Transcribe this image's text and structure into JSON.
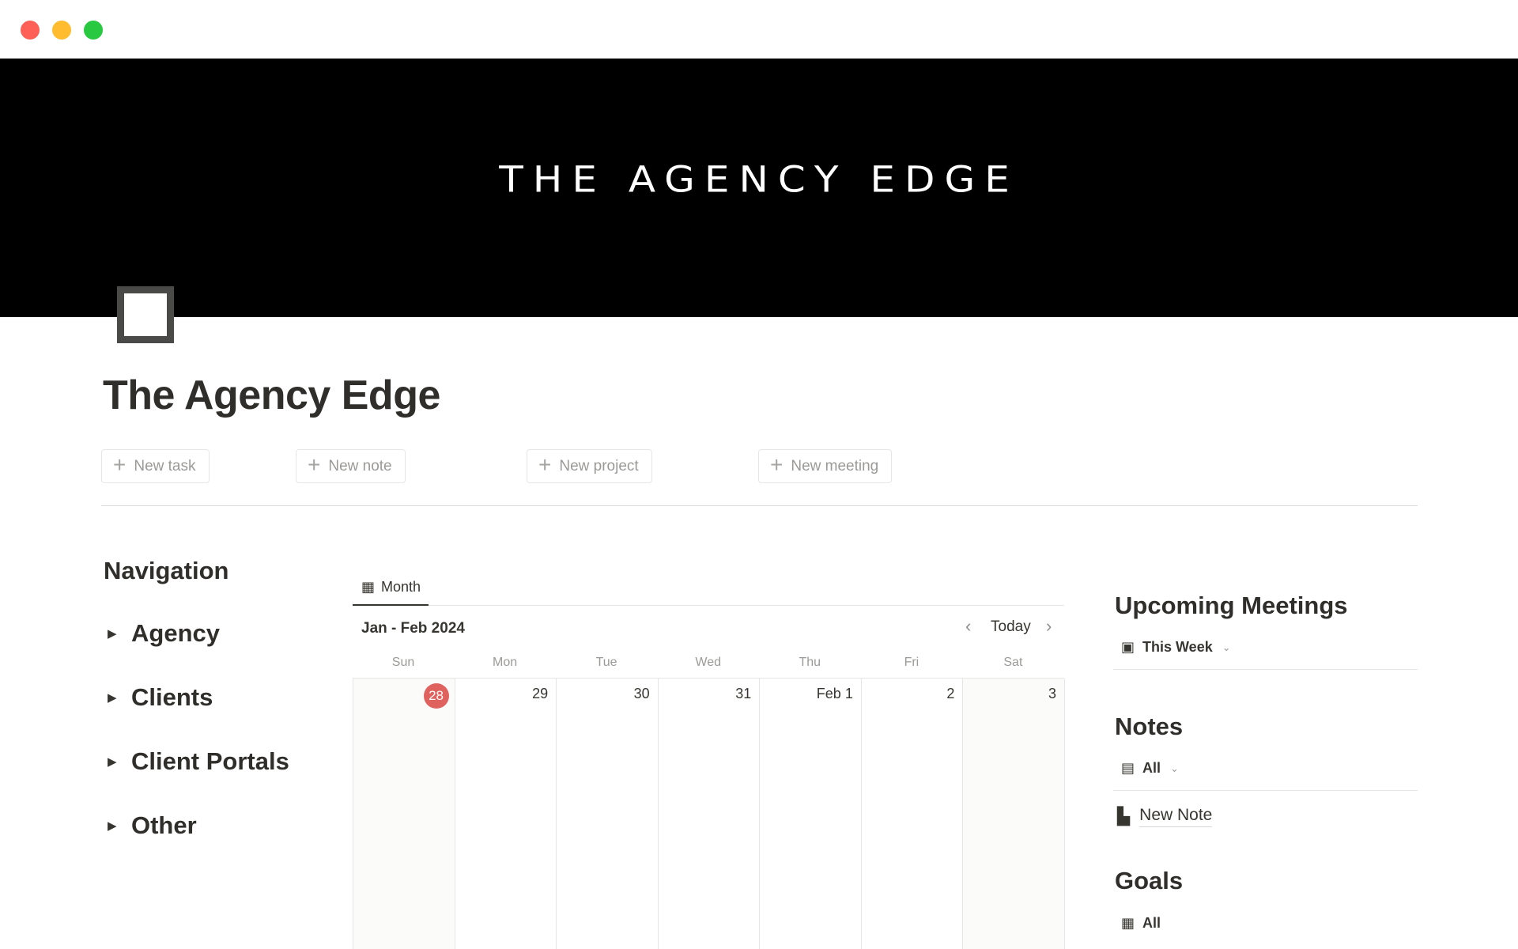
{
  "cover": {
    "title": "THE AGENCY EDGE"
  },
  "page": {
    "title": "The Agency Edge"
  },
  "actions": {
    "new_task": "New task",
    "new_note": "New note",
    "new_project": "New project",
    "new_meeting": "New meeting"
  },
  "navigation": {
    "heading": "Navigation",
    "items": [
      "Agency",
      "Clients",
      "Client Portals",
      "Other"
    ]
  },
  "calendar": {
    "tab": "Month",
    "range": "Jan - Feb 2024",
    "today_label": "Today",
    "weekdays": [
      "Sun",
      "Mon",
      "Tue",
      "Wed",
      "Thu",
      "Fri",
      "Sat"
    ],
    "days": [
      "28",
      "29",
      "30",
      "31",
      "Feb 1",
      "2",
      "3"
    ],
    "today_day": "28"
  },
  "upcoming_meetings": {
    "heading": "Upcoming Meetings",
    "view": "This Week"
  },
  "notes": {
    "heading": "Notes",
    "view": "All",
    "items": [
      "New Note"
    ]
  },
  "goals": {
    "heading": "Goals",
    "view": "All"
  },
  "colors": {
    "today": "#e0625e",
    "cover": "#000000",
    "text": "#37352f"
  }
}
